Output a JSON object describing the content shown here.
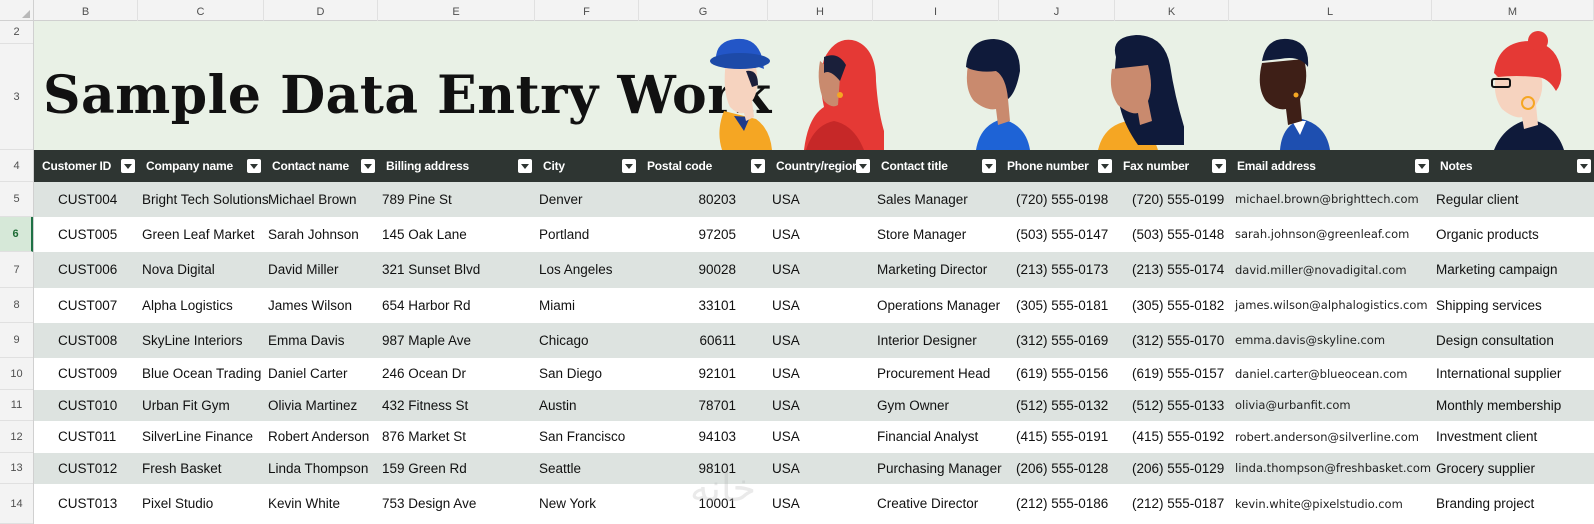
{
  "columns": [
    "B",
    "C",
    "D",
    "E",
    "F",
    "G",
    "H",
    "I",
    "J",
    "K",
    "L",
    "M"
  ],
  "rows": [
    "2",
    "3",
    "4",
    "5",
    "6",
    "7",
    "8",
    "9",
    "10",
    "11",
    "12",
    "13",
    "14"
  ],
  "selected_row": "6",
  "banner": {
    "title": "Sample Data Entry Work"
  },
  "headers": [
    "Customer ID",
    "Company name",
    "Contact name",
    "Billing address",
    "City",
    "Postal code",
    "Country/region",
    "Contact title",
    "Phone number",
    "Fax number",
    "Email address",
    "Notes"
  ],
  "records": [
    [
      "CUST004",
      "Bright Tech Solutions",
      "Michael Brown",
      "789 Pine St",
      "Denver",
      "80203",
      "USA",
      "Sales Manager",
      "(720) 555-0198",
      "(720) 555-0199",
      "michael.brown@brighttech.com",
      "Regular client"
    ],
    [
      "CUST005",
      "Green Leaf Market",
      "Sarah Johnson",
      "145 Oak Lane",
      "Portland",
      "97205",
      "USA",
      "Store Manager",
      "(503) 555-0147",
      "(503) 555-0148",
      "sarah.johnson@greenleaf.com",
      "Organic products"
    ],
    [
      "CUST006",
      "Nova Digital",
      "David Miller",
      "321 Sunset Blvd",
      "Los Angeles",
      "90028",
      "USA",
      "Marketing Director",
      "(213) 555-0173",
      "(213) 555-0174",
      "david.miller@novadigital.com",
      "Marketing campaign"
    ],
    [
      "CUST007",
      "Alpha Logistics",
      "James Wilson",
      "654 Harbor Rd",
      "Miami",
      "33101",
      "USA",
      "Operations Manager",
      "(305) 555-0181",
      "(305) 555-0182",
      "james.wilson@alphalogistics.com",
      "Shipping services"
    ],
    [
      "CUST008",
      "SkyLine Interiors",
      "Emma Davis",
      "987 Maple Ave",
      "Chicago",
      "60611",
      "USA",
      "Interior Designer",
      "(312) 555-0169",
      "(312) 555-0170",
      "emma.davis@skyline.com",
      "Design consultation"
    ],
    [
      "CUST009",
      "Blue Ocean Trading",
      "Daniel Carter",
      "246 Ocean Dr",
      "San Diego",
      "92101",
      "USA",
      "Procurement Head",
      "(619) 555-0156",
      "(619) 555-0157",
      "daniel.carter@blueocean.com",
      "International supplier"
    ],
    [
      "CUST010",
      "Urban Fit Gym",
      "Olivia Martinez",
      "432 Fitness St",
      "Austin",
      "78701",
      "USA",
      "Gym Owner",
      "(512) 555-0132",
      "(512) 555-0133",
      "olivia@urbanfit.com",
      "Monthly membership"
    ],
    [
      "CUST011",
      "SilverLine Finance",
      "Robert Anderson",
      "876 Market St",
      "San Francisco",
      "94103",
      "USA",
      "Financial Analyst",
      "(415) 555-0191",
      "(415) 555-0192",
      "robert.anderson@silverline.com",
      "Investment client"
    ],
    [
      "CUST012",
      "Fresh Basket",
      "Linda Thompson",
      "159 Green Rd",
      "Seattle",
      "98101",
      "USA",
      "Purchasing Manager",
      "(206) 555-0128",
      "(206) 555-0129",
      "linda.thompson@freshbasket.com",
      "Grocery supplier"
    ],
    [
      "CUST013",
      "Pixel Studio",
      "Kevin White",
      "753 Design Ave",
      "New York",
      "10001",
      "USA",
      "Creative Director",
      "(212) 555-0186",
      "(212) 555-0187",
      "kevin.white@pixelstudio.com",
      "Branding project"
    ]
  ],
  "watermark": "خانه",
  "colors": {
    "header_bg": "#2e3532",
    "band": "#dde3e0",
    "banner_bg": "#e9f1e6"
  },
  "icons": [
    "filter-dropdown-icon",
    "person-blue-hat-icon",
    "person-red-hijab-icon",
    "person-short-hair-icon",
    "person-long-hair-icon",
    "person-dark-skin-icon",
    "person-red-hair-icon"
  ]
}
